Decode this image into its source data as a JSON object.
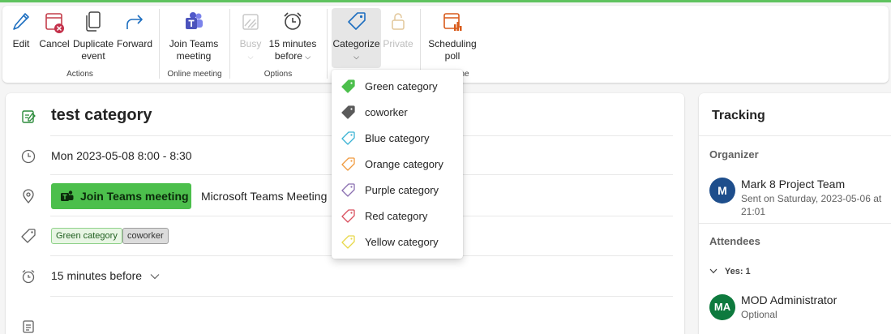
{
  "ribbon": {
    "edit": "Edit",
    "cancel": "Cancel",
    "duplicate_l1": "Duplicate",
    "duplicate_l2": "event",
    "forward": "Forward",
    "group_actions": "Actions",
    "join_l1": "Join Teams",
    "join_l2": "meeting",
    "group_online": "Online meeting",
    "busy": "Busy",
    "reminder_l1": "15 minutes",
    "reminder_l2": "before",
    "group_options": "Options",
    "categorize": "Categorize",
    "private": "Private",
    "scheduling_l1": "Scheduling",
    "scheduling_l2": "poll",
    "group_partial": "ne"
  },
  "event": {
    "title": "test category",
    "datetime": "Mon 2023-05-08 8:00 - 8:30",
    "join_button": "Join Teams meeting",
    "location": "Microsoft Teams Meeting",
    "categories": [
      "Green category",
      "coworker"
    ],
    "reminder": "15 minutes before"
  },
  "menu": {
    "items": [
      {
        "label": "Green category",
        "color": "#4cbf4c",
        "filled": true
      },
      {
        "label": "coworker",
        "color": "#5a5a5a",
        "filled": true
      },
      {
        "label": "Blue category",
        "color": "#3bb3d4",
        "filled": false
      },
      {
        "label": "Orange category",
        "color": "#f09a3e",
        "filled": false
      },
      {
        "label": "Purple category",
        "color": "#8a6fb0",
        "filled": false
      },
      {
        "label": "Red category",
        "color": "#d9505f",
        "filled": false
      },
      {
        "label": "Yellow category",
        "color": "#e8d84a",
        "filled": false
      }
    ]
  },
  "tracking": {
    "title": "Tracking",
    "organizer_label": "Organizer",
    "organizer_initials": "M",
    "organizer_name": "Mark 8 Project Team",
    "organizer_sent": "Sent on Saturday, 2023-05-06 at 21:01",
    "attendees_label": "Attendees",
    "yes_label": "Yes: 1",
    "attendee_initials": "MA",
    "attendee_name": "MOD Administrator",
    "attendee_role": "Optional"
  },
  "colors": {
    "accent_green": "#4cbf4c",
    "organizer_avatar": "#1e4e8c",
    "attendee_avatar": "#0e7a3e"
  }
}
